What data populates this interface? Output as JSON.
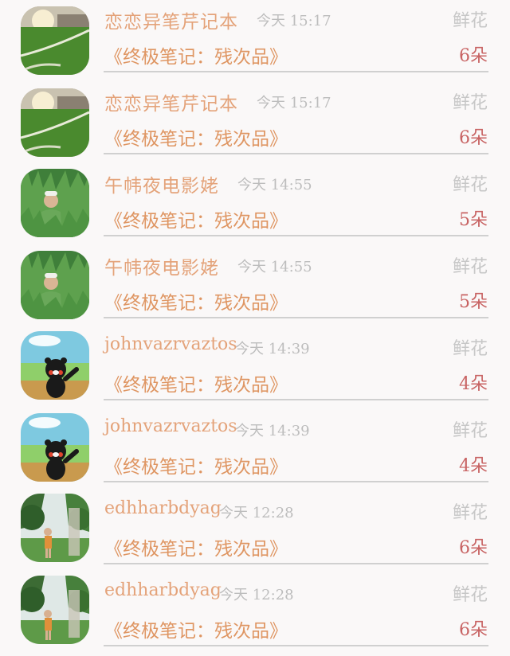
{
  "gift_records": [
    {
      "sender": "恋恋异笔芹记本",
      "time": "今天 15:17",
      "gift_type": "鲜花",
      "message": "《终极笔记：残次品》",
      "count": "6朵",
      "avatar": "field-goal-icon"
    },
    {
      "sender": "恋恋异笔芹记本",
      "time": "今天 15:17",
      "gift_type": "鲜花",
      "message": "《终极笔记：残次品》",
      "count": "6朵",
      "avatar": "field-goal-icon"
    },
    {
      "sender": "午帏夜电影姥",
      "time": "今天 14:55",
      "gift_type": "鲜花",
      "message": "《终极笔记：残次品》",
      "count": "5朵",
      "avatar": "grass-person-icon"
    },
    {
      "sender": "午帏夜电影姥",
      "time": "今天 14:55",
      "gift_type": "鲜花",
      "message": "《终极笔记：残次品》",
      "count": "5朵",
      "avatar": "grass-person-icon"
    },
    {
      "sender": "johnvazrvaztos",
      "time": "今天 14:39",
      "gift_type": "鲜花",
      "message": "《终极笔记：残次品》",
      "count": "4朵",
      "avatar": "kumamon-icon"
    },
    {
      "sender": "johnvazrvaztos",
      "time": "今天 14:39",
      "gift_type": "鲜花",
      "message": "《终极笔记：残次品》",
      "count": "4朵",
      "avatar": "kumamon-icon"
    },
    {
      "sender": "edhharbdyag",
      "time": "今天 12:28",
      "gift_type": "鲜花",
      "message": "《终极笔记：残次品》",
      "count": "6朵",
      "avatar": "forest-girl-icon"
    },
    {
      "sender": "edhharbdyag",
      "time": "今天 12:28",
      "gift_type": "鲜花",
      "message": "《终极笔记：残次品》",
      "count": "6朵",
      "avatar": "forest-girl-icon"
    }
  ],
  "colors": {
    "background": "#faf8f8",
    "sender": "#e4a37a",
    "message": "#df9663",
    "count": "#c86363",
    "muted": "#bdbdbd",
    "divider": "#d0d0d0"
  }
}
